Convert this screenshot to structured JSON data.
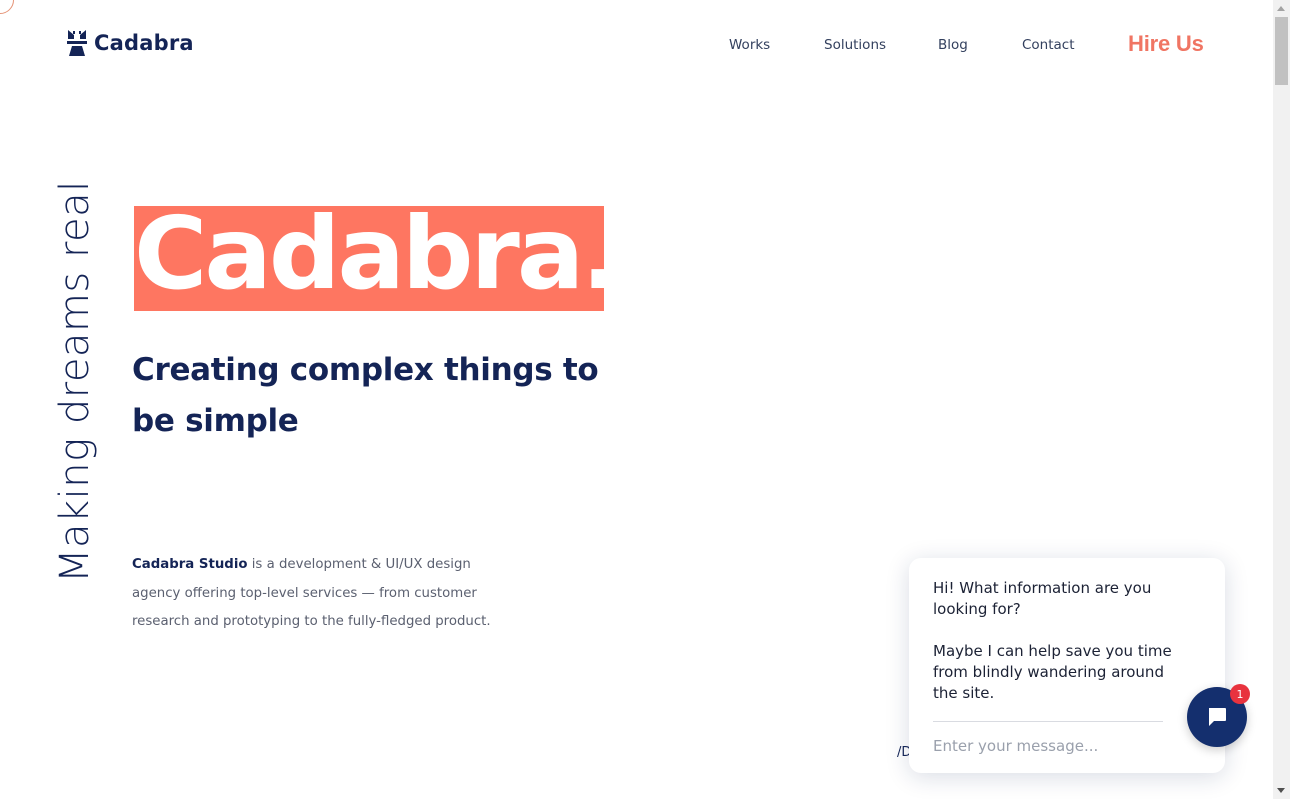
{
  "header": {
    "logo_text": "Cadabra",
    "nav": [
      {
        "label": "Works"
      },
      {
        "label": "Solutions"
      },
      {
        "label": "Blog"
      },
      {
        "label": "Contact"
      }
    ],
    "cta_label": "Hire Us"
  },
  "hero": {
    "vertical_text": "Making dreams real",
    "brand_word": "Cadabra.",
    "tagline": "Creating complex things to be simple",
    "description_strong": "Cadabra Studio",
    "description_rest": " is a development & UI/UX design agency offering top-level services — from customer research and prototyping to the fully-fledged product.",
    "stray_text": "/D"
  },
  "chat": {
    "message_1": "Hi! What information are you looking for?",
    "message_2": "Maybe I can help save you time from blindly wandering around the site.",
    "input_placeholder": "Enter your message...",
    "badge_count": "1"
  },
  "colors": {
    "brand_navy": "#142456",
    "accent_coral": "#fe7661",
    "hire_us": "#f07563",
    "chat_button": "#142f6e",
    "badge": "#e8333e"
  }
}
